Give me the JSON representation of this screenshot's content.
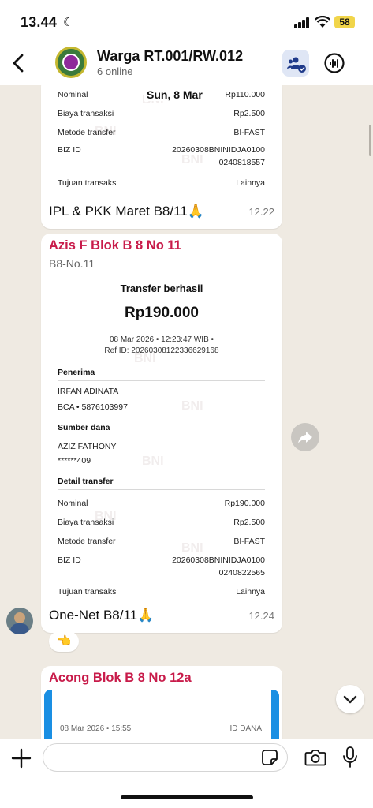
{
  "status_bar": {
    "time": "13.44",
    "battery": "58"
  },
  "header": {
    "title": "Warga RT.001/RW.012",
    "subtitle": "6 online"
  },
  "messages": [
    {
      "date_label": "Sun, 8 Mar",
      "receipt_rows": [
        {
          "key": "Nominal",
          "value": "Rp110.000"
        },
        {
          "key": "Biaya transaksi",
          "value": "Rp2.500"
        },
        {
          "key": "Metode transfer",
          "value": "BI-FAST"
        },
        {
          "key": "BIZ ID",
          "value": "20260308BNINIDJA0100",
          "value2": "0240818557"
        },
        {
          "key": "Tujuan transaksi",
          "value": "Lainnya"
        }
      ],
      "caption": "IPL & PKK Maret B8/11🙏",
      "time": "12.22"
    },
    {
      "sender": "Azis F Blok B 8 No 11",
      "sender_sub": "B8-No.11",
      "receipt": {
        "title": "Transfer berhasil",
        "amount": "Rp190.000",
        "datetime": "08 Mar 2026 • 12:23:47 WIB •",
        "ref": "Ref ID: 20260308122336629168",
        "penerima_label": "Penerima",
        "penerima_name": "IRFAN ADINATA",
        "penerima_acc": "BCA • 5876103997",
        "sumber_label": "Sumber dana",
        "sumber_name": "AZIZ FATHONY",
        "sumber_acc": "******409",
        "detail_label": "Detail transfer",
        "rows": [
          {
            "key": "Nominal",
            "value": "Rp190.000"
          },
          {
            "key": "Biaya transaksi",
            "value": "Rp2.500"
          },
          {
            "key": "Metode transfer",
            "value": "BI-FAST"
          },
          {
            "key": "BIZ ID",
            "value": "20260308BNINIDJA0100",
            "value2": "0240822565"
          },
          {
            "key": "Tujuan transaksi",
            "value": "Lainnya"
          }
        ]
      },
      "caption": "One-Net B8/11🙏",
      "time": "12.24",
      "reaction": "👈"
    },
    {
      "sender": "Acong Blok B 8 No 12a",
      "dana_meta": "08 Mar 2026 • 15:55",
      "dana_id": "ID DANA"
    }
  ],
  "watermark": "BNI",
  "colors": {
    "sender_name": "#c81b4a",
    "dana_blue": "#1a8fe3",
    "chat_bg": "#efeae2"
  },
  "icons": [
    "back-arrow-icon",
    "community-icon",
    "call-icon",
    "forward-icon",
    "chevron-down-icon",
    "plus-icon",
    "sticker-icon",
    "camera-icon",
    "mic-icon"
  ]
}
